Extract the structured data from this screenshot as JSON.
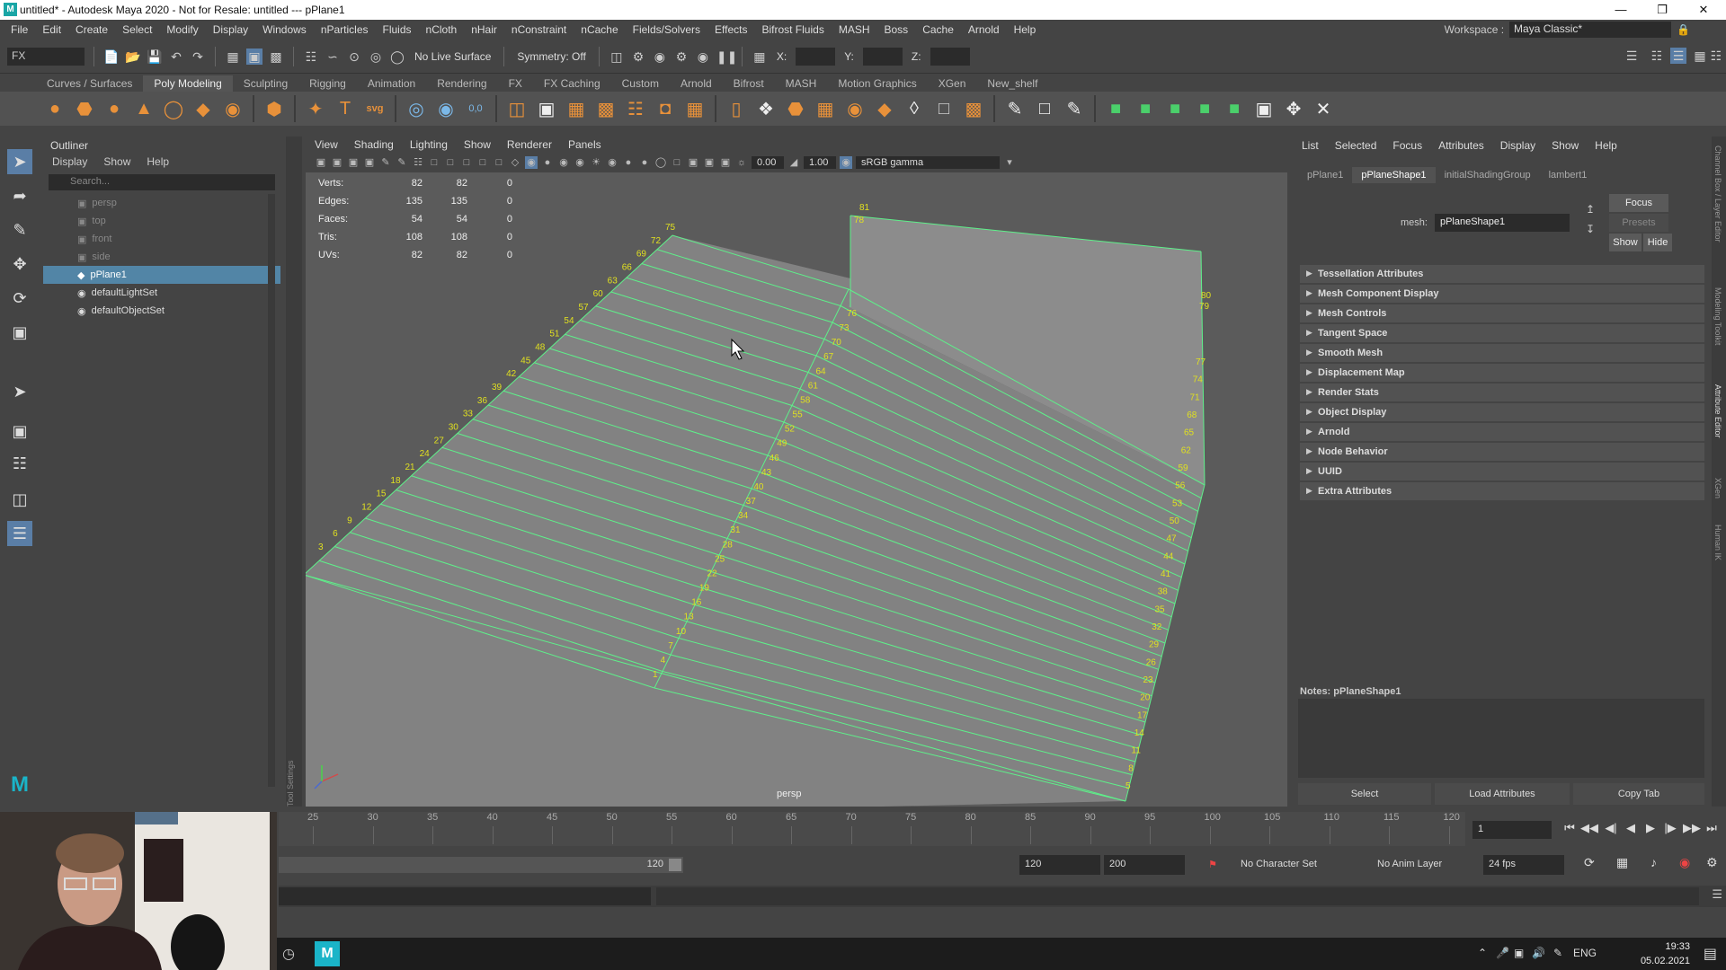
{
  "window": {
    "title": "untitled* - Autodesk Maya 2020 - Not for Resale: untitled   ---   pPlane1",
    "app_icon": "maya-icon"
  },
  "menu": [
    "File",
    "Edit",
    "Create",
    "Select",
    "Modify",
    "Display",
    "Windows",
    "nParticles",
    "Fluids",
    "nCloth",
    "nHair",
    "nConstraint",
    "nCache",
    "Fields/Solvers",
    "Effects",
    "Bifrost Fluids",
    "MASH",
    "Boss",
    "Cache",
    "Arnold",
    "Help"
  ],
  "workspace": {
    "label": "Workspace :",
    "value": "Maya Classic*"
  },
  "statusline": {
    "mode": "FX",
    "live_surface": "No Live Surface",
    "symmetry": "Symmetry: Off",
    "x_label": "X:",
    "y_label": "Y:",
    "z_label": "Z:"
  },
  "shelf_tabs": [
    "Curves / Surfaces",
    "Poly Modeling",
    "Sculpting",
    "Rigging",
    "Animation",
    "Rendering",
    "FX",
    "FX Caching",
    "Custom",
    "Arnold",
    "Bifrost",
    "MASH",
    "Motion Graphics",
    "XGen",
    "New_shelf"
  ],
  "shelf_active": "Poly Modeling",
  "outliner": {
    "title": "Outliner",
    "menu": [
      "Display",
      "Show",
      "Help"
    ],
    "search_placeholder": "Search...",
    "items": [
      {
        "label": "persp",
        "state": "dim",
        "icon": "camera-icon"
      },
      {
        "label": "top",
        "state": "dim",
        "icon": "camera-icon"
      },
      {
        "label": "front",
        "state": "dim",
        "icon": "camera-icon"
      },
      {
        "label": "side",
        "state": "dim",
        "icon": "camera-icon"
      },
      {
        "label": "pPlane1",
        "state": "sel",
        "icon": "mesh-icon"
      },
      {
        "label": "defaultLightSet",
        "state": "normal",
        "icon": "set-icon"
      },
      {
        "label": "defaultObjectSet",
        "state": "normal",
        "icon": "set-icon"
      }
    ]
  },
  "toolset_label": "Tool Settings",
  "viewport": {
    "menu": [
      "View",
      "Shading",
      "Lighting",
      "Show",
      "Renderer",
      "Panels"
    ],
    "exposure": "0.00",
    "gamma": "1.00",
    "colorspace": "sRGB gamma",
    "camera": "persp",
    "hud": [
      {
        "label": "Verts:",
        "a": "82",
        "b": "82",
        "c": "0"
      },
      {
        "label": "Edges:",
        "a": "135",
        "b": "135",
        "c": "0"
      },
      {
        "label": "Faces:",
        "a": "54",
        "b": "54",
        "c": "0"
      },
      {
        "label": "Tris:",
        "a": "108",
        "b": "108",
        "c": "0"
      },
      {
        "label": "UVs:",
        "a": "82",
        "b": "82",
        "c": "0"
      }
    ],
    "vertex_labels": {
      "left_edge": [
        "3",
        "6",
        "9",
        "12",
        "15",
        "18",
        "21",
        "24",
        "27",
        "30",
        "33",
        "36",
        "39",
        "42",
        "45",
        "48",
        "51",
        "54",
        "57",
        "60",
        "63",
        "66",
        "69",
        "72",
        "75"
      ],
      "mid_edge": [
        "1",
        "4",
        "7",
        "10",
        "13",
        "16",
        "19",
        "22",
        "25",
        "28",
        "31",
        "34",
        "37",
        "40",
        "43",
        "46",
        "49",
        "52",
        "55",
        "58",
        "61",
        "64",
        "67",
        "70",
        "73",
        "76"
      ],
      "right_edge": [
        "5",
        "8",
        "11",
        "14",
        "17",
        "20",
        "23",
        "26",
        "29",
        "32",
        "35",
        "38",
        "41",
        "44",
        "47",
        "50",
        "53",
        "56",
        "59",
        "62",
        "65",
        "68",
        "71",
        "74",
        "77"
      ],
      "corners": [
        "78",
        "81",
        "80",
        "79"
      ]
    }
  },
  "attribute_editor": {
    "menu": [
      "List",
      "Selected",
      "Focus",
      "Attributes",
      "Display",
      "Show",
      "Help"
    ],
    "tabs": [
      "pPlane1",
      "pPlaneShape1",
      "initialShadingGroup",
      "lambert1"
    ],
    "active_tab": "pPlaneShape1",
    "mesh_label": "mesh:",
    "mesh_value": "pPlaneShape1",
    "focus": "Focus",
    "presets": "Presets",
    "show": "Show",
    "hide": "Hide",
    "sections": [
      "Tessellation Attributes",
      "Mesh Component Display",
      "Mesh Controls",
      "Tangent Space",
      "Smooth Mesh",
      "Displacement Map",
      "Render Stats",
      "Object Display",
      "Arnold",
      "Node Behavior",
      "UUID",
      "Extra Attributes"
    ],
    "notes": "Notes:  pPlaneShape1",
    "buttons": [
      "Select",
      "Load Attributes",
      "Copy Tab"
    ]
  },
  "right_strip": [
    "Channel Box / Layer Editor",
    "Modeling Toolkit",
    "Attribute Editor",
    "XGen",
    "Human IK"
  ],
  "timeline": {
    "ticks": [
      "25",
      "30",
      "35",
      "40",
      "45",
      "50",
      "55",
      "60",
      "65",
      "70",
      "75",
      "80",
      "85",
      "90",
      "95",
      "100",
      "105",
      "110",
      "115",
      "120"
    ],
    "current_frame": "1"
  },
  "range": {
    "range_end_marker": "120",
    "end": "120",
    "max": "200",
    "character_set": "No Character Set",
    "anim_layer": "No Anim Layer",
    "fps": "24 fps"
  },
  "taskbar": {
    "lang": "ENG",
    "time": "19:33",
    "date": "05.02.2021"
  },
  "colors": {
    "selection": "#5285a6",
    "wire": "#5ef08a",
    "vertex_number": "#e0e020"
  }
}
